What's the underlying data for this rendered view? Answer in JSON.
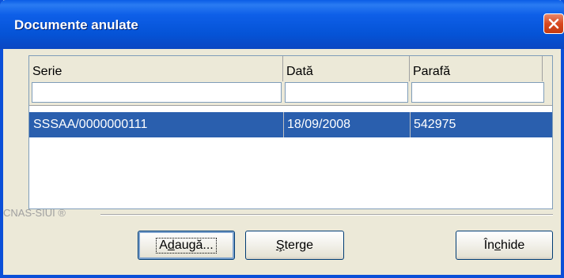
{
  "window": {
    "title": "Documente anulate",
    "close_icon": "close-icon"
  },
  "grid": {
    "columns": [
      {
        "label": "Serie"
      },
      {
        "label": "Dată"
      },
      {
        "label": "Parafă"
      }
    ],
    "filters": [
      "",
      "",
      ""
    ],
    "rows": [
      {
        "serie": "SSSAA/0000000111",
        "data": "18/09/2008",
        "parafa": "542975",
        "selected": true
      }
    ]
  },
  "footer": {
    "brand": "CNAS-SIUI ®"
  },
  "buttons": {
    "add_label_pre": "A",
    "add_label_mn": "d",
    "add_label_post": "augă...",
    "delete_label_pre": "",
    "delete_label_mn": "Ş",
    "delete_label_post": "terge",
    "close_label_pre": "În",
    "close_label_mn": "c",
    "close_label_post": "hide"
  },
  "colors": {
    "titlebar": "#0553d6",
    "selection": "#2a5fae",
    "dialog_bg": "#ece9d8"
  }
}
